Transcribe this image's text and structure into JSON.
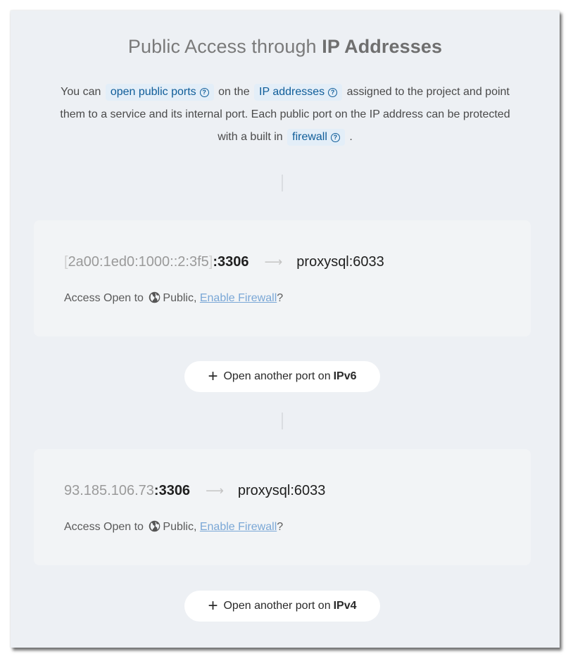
{
  "section": {
    "title_prefix": "Public Access through ",
    "title_bold": "IP Addresses",
    "desc": {
      "t1": "You can ",
      "chip1": "open public ports",
      "t2": " on the ",
      "chip2": "IP addresses",
      "t3": " assigned to the project and point them to a service and its internal port. Each public port on the IP address can be protected with a built in ",
      "chip3": "firewall",
      "t4": " ."
    },
    "help_glyph": "?"
  },
  "entries": [
    {
      "bracket_open": "[",
      "ip": "2a00:1ed0:1000::2:3f5",
      "bracket_close": "]",
      "port": ":3306",
      "arrow": "⟶",
      "target": "proxysql:6033",
      "access_prefix": "Access Open to ",
      "access_scope": "Public, ",
      "firewall_link": "Enable Firewall",
      "access_suffix": "?",
      "add_prefix": "Open another port on ",
      "add_bold": "IPv6"
    },
    {
      "ip": "93.185.106.73",
      "port": ":3306",
      "arrow": "⟶",
      "target": "proxysql:6033",
      "access_prefix": "Access Open to ",
      "access_scope": "Public, ",
      "firewall_link": "Enable Firewall",
      "access_suffix": "?",
      "add_prefix": "Open another port on ",
      "add_bold": "IPv4"
    }
  ],
  "icons": {
    "plus": "+",
    "globe": "globe-icon",
    "help": "help-circle-icon"
  }
}
